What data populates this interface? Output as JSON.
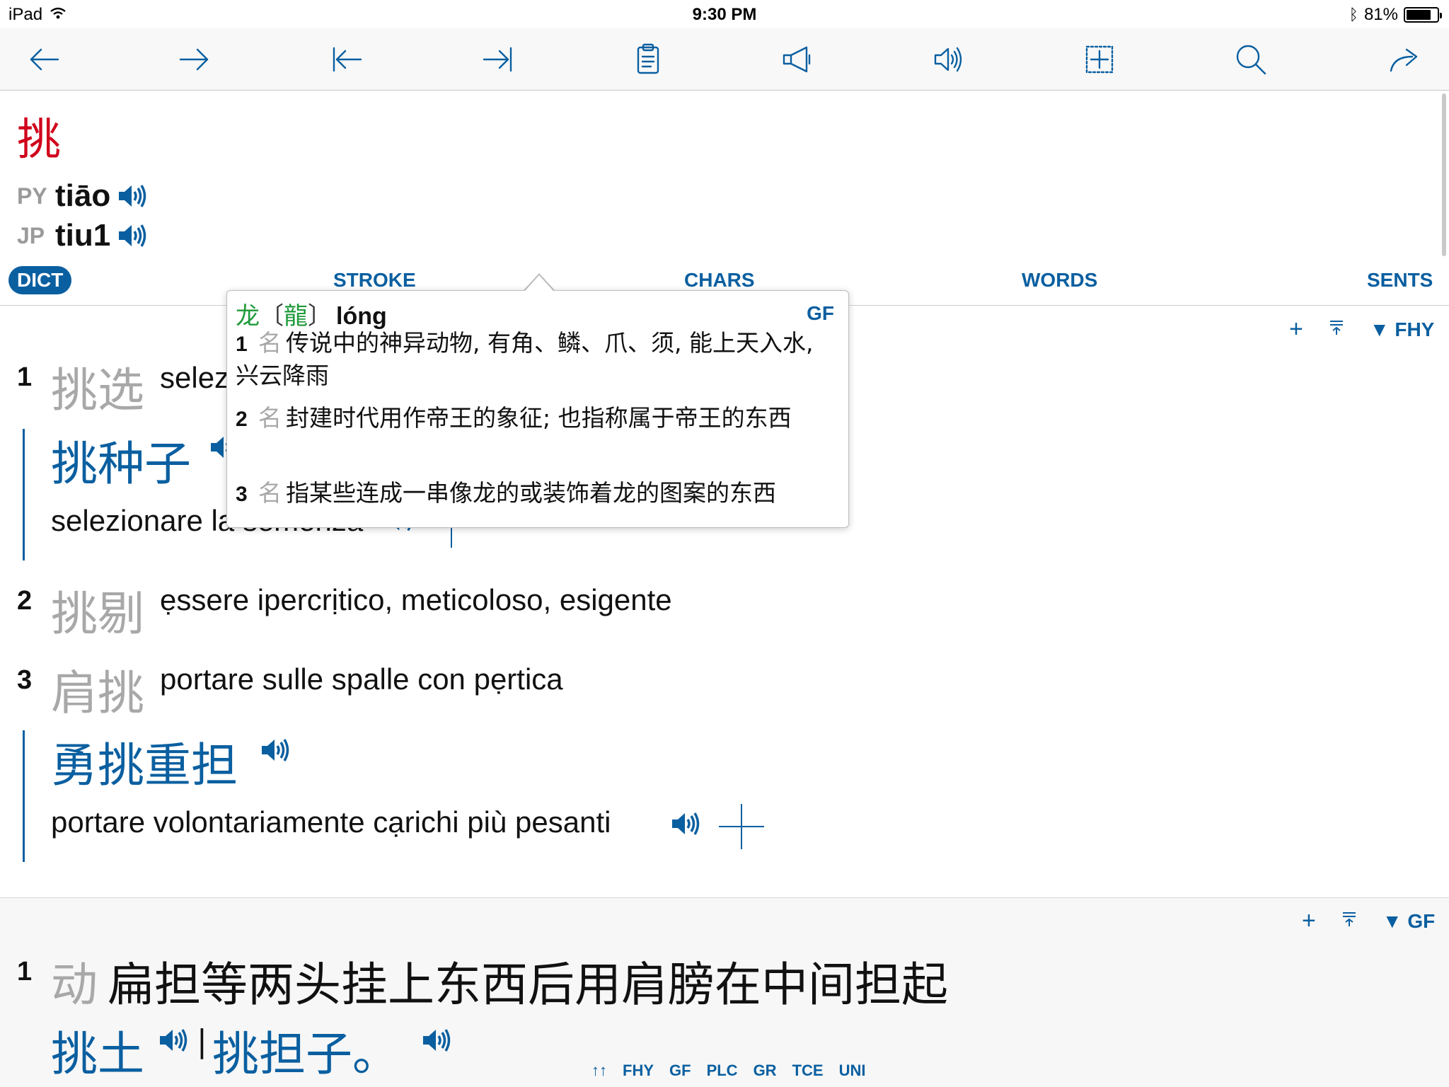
{
  "status": {
    "device": "iPad",
    "time": "9:30 PM",
    "battery": "81%",
    "battery_level": 0.81
  },
  "toolbar": {
    "icons": [
      "arrow-left-icon",
      "arrow-right-icon",
      "first-icon",
      "last-icon",
      "clipboard-icon",
      "megaphone-icon",
      "speaker-icon",
      "add-box-icon",
      "search-icon",
      "share-icon"
    ]
  },
  "entry": {
    "headword": "挑",
    "pronunciations": [
      {
        "tag": "PY",
        "value": "tiāo"
      },
      {
        "tag": "JP",
        "value": "tiu1"
      }
    ]
  },
  "tabs": {
    "dict": "DICT",
    "stroke": "STROKE",
    "chars": "CHARS",
    "words": "WORDS",
    "sents": "SENTS"
  },
  "section1": {
    "plus": "+",
    "source": "▼ FHY",
    "items": [
      {
        "num": "1",
        "word": "挑选",
        "gloss": "selezionare, scegliere",
        "example": {
          "cn": "挑种子",
          "it": "selezionare la semenza"
        }
      },
      {
        "num": "2",
        "word": "挑剔",
        "gloss": "ẹssere ipercrịtico, meticoloso, esigente"
      },
      {
        "num": "3",
        "word": "肩挑",
        "gloss": "portare sulle spalle con pẹrtica",
        "example": {
          "cn": "勇挑重担",
          "it": "portare volontariamente cạrichi più pesanti"
        }
      }
    ]
  },
  "section2": {
    "plus": "+",
    "source": "▼ GF",
    "items": [
      {
        "num": "1",
        "pos": "动",
        "def": "扁担等两头挂上东西后用肩膀在中间担起",
        "ex1": "挑土",
        "sep": "|",
        "ex2": "挑担子。"
      }
    ]
  },
  "footer": {
    "arrows": "↑↑",
    "links": [
      "FHY",
      "GF",
      "PLC",
      "GR",
      "TCE",
      "UNI"
    ]
  },
  "popup": {
    "simp": "龙",
    "trad_open": "〔",
    "trad": "龍",
    "trad_close": "〕",
    "pinyin": "lóng",
    "source": "GF",
    "senses": [
      {
        "n": "1",
        "pos": "名",
        "text": "传说中的神异动物, 有角、鳞、爪、须, 能上天入水, 兴云降雨"
      },
      {
        "n": "2",
        "pos": "名",
        "text": "封建时代用作帝王的象征; 也指称属于帝王的东西"
      },
      {
        "n": "3",
        "pos": "名",
        "text": "指某些连成一串像龙的或装饰着龙的图案的东西"
      }
    ]
  }
}
